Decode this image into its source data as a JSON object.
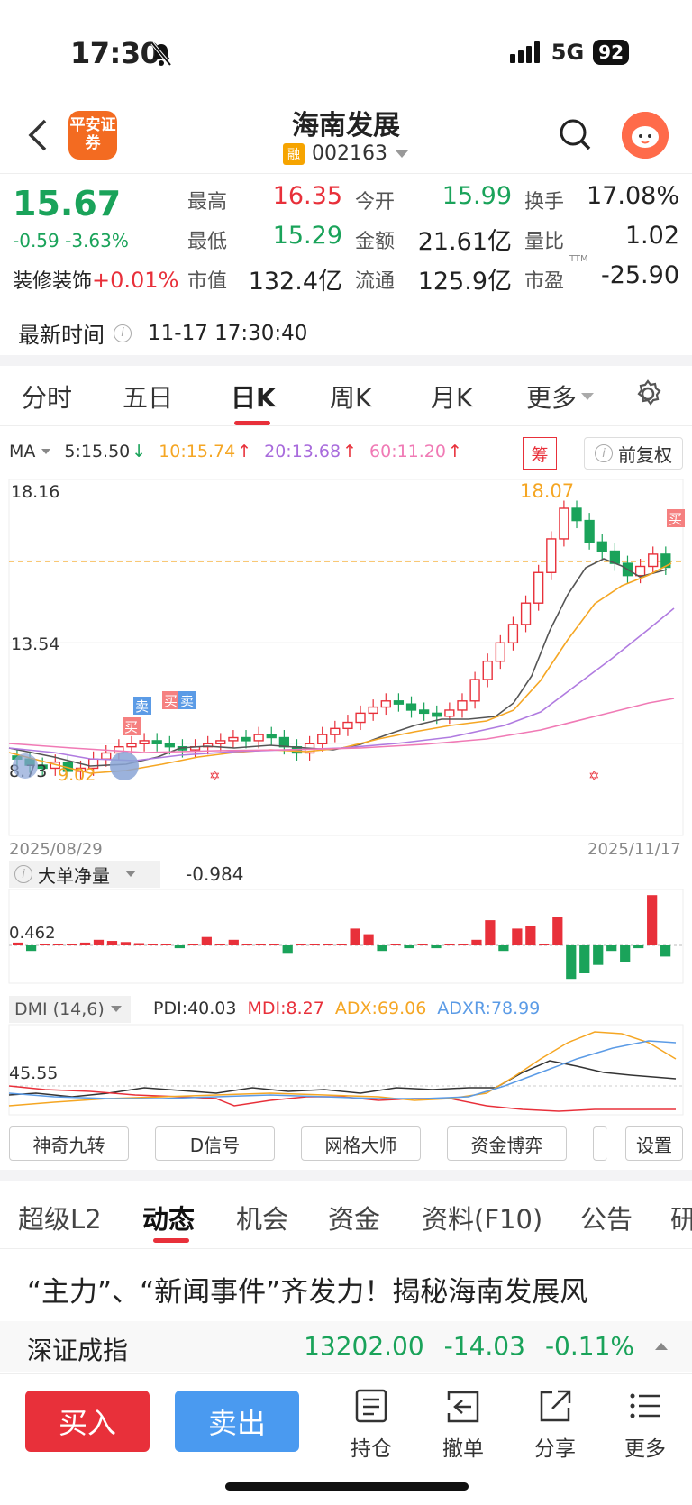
{
  "status_bar": {
    "time": "17:30",
    "network": "5G",
    "battery": "92"
  },
  "header": {
    "logo_text": "平安证券",
    "stock_name": "海南发展",
    "rong_badge": "融",
    "stock_code": "002163"
  },
  "quote": {
    "price": "15.67",
    "change": "-0.59  -3.63%",
    "sector_name": "装修装饰",
    "sector_change": "+0.01%",
    "fields": [
      {
        "label": "最高",
        "value": "16.35",
        "color": "#e8303a"
      },
      {
        "label": "今开",
        "value": "15.99",
        "color": "#1aa35a"
      },
      {
        "label": "换手",
        "value": "17.08%",
        "color": "#222"
      },
      {
        "label": "最低",
        "value": "15.29",
        "color": "#1aa35a"
      },
      {
        "label": "金额",
        "value": "21.61亿",
        "color": "#222"
      },
      {
        "label": "量比",
        "value": "1.02",
        "color": "#222"
      },
      {
        "label": "市值",
        "value": "132.4亿",
        "color": "#222"
      },
      {
        "label": "流通",
        "value": "125.9亿",
        "color": "#222"
      },
      {
        "label": "市盈",
        "value": "-25.90",
        "color": "#222"
      }
    ],
    "ttm": "TTM",
    "time_label": "最新时间",
    "time_value": "11-17 17:30:40"
  },
  "period_tabs": [
    "分时",
    "五日",
    "日K",
    "周K",
    "月K",
    "更多"
  ],
  "ma": {
    "label": "MA",
    "ma5": "5:15.50",
    "ma10": "10:15.74",
    "ma20": "20:13.68",
    "ma60": "60:11.20",
    "chou": "筹",
    "fuquan": "前复权"
  },
  "chart": {
    "y_top": "18.16",
    "y_mid": "13.54",
    "y_bot": "8.73",
    "high_label": "18.07",
    "low_label": "9.02",
    "date_start": "2025/08/29",
    "date_end": "2025/11/17",
    "sell_label": "卖",
    "buy_label": "买"
  },
  "chart_data": {
    "type": "candlestick",
    "title": "",
    "x_range": [
      "2025/08/29",
      "2025/11/17"
    ],
    "ylim": [
      8.73,
      18.16
    ],
    "ma_values": {
      "MA5": 15.5,
      "MA10": 15.74,
      "MA20": 13.68,
      "MA60": 11.2
    },
    "high": 18.07,
    "low": 9.02
  },
  "volume_indicator": {
    "label": "大单净量",
    "value": "-0.984",
    "axis_label": "0.462"
  },
  "dmi": {
    "label": "DMI (14,6)",
    "pdi": "PDI:40.03",
    "mdi": "MDI:8.27",
    "adx": "ADX:69.06",
    "adxr": "ADXR:78.99",
    "axis_label": "45.55"
  },
  "tool_buttons": [
    "神奇九转",
    "D信号",
    "网格大师",
    "资金博弈",
    "设置"
  ],
  "section_tabs": [
    "超级L2",
    "动态",
    "机会",
    "资金",
    "资料(F10)",
    "公告",
    "研"
  ],
  "headline": "“主力”、“新闻事件”齐发力！揭秘海南发展风",
  "index_bar": {
    "name": "深证成指",
    "value": "13202.00",
    "change": "-14.03",
    "pct": "-0.11%"
  },
  "bottom_nav": {
    "buy": "买入",
    "sell": "卖出",
    "items": [
      "持仓",
      "撤单",
      "分享",
      "更多"
    ]
  }
}
